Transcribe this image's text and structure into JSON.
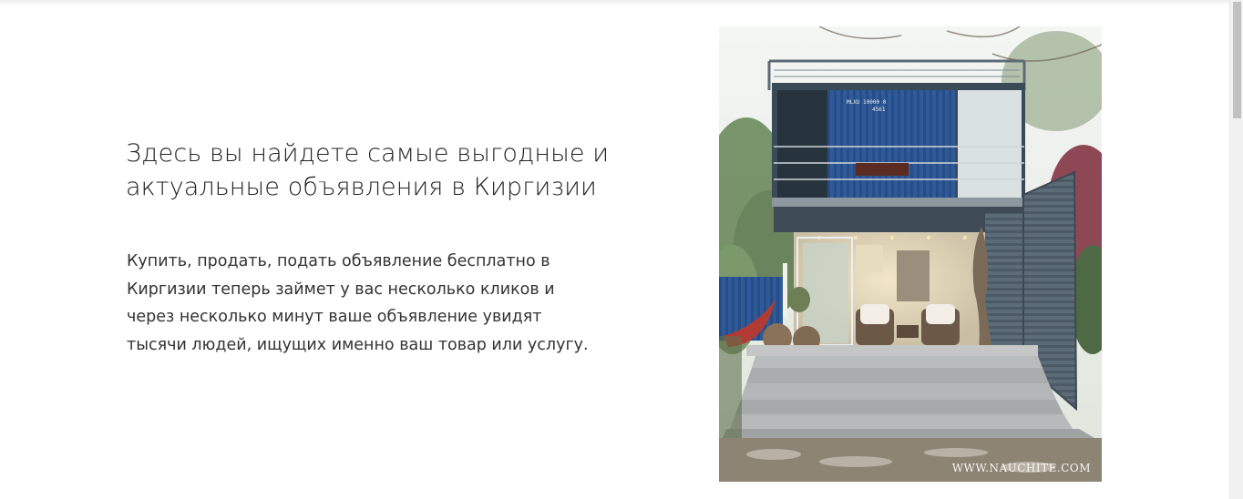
{
  "content": {
    "headline": "Здесь вы найдете самые выгодные и актуальные объявления в Киргизии",
    "description": "Купить, продать, подать объявление бесплатно в Киргизии теперь займет у вас несколько кликов и через несколько минут ваше объявление увидят тысячи людей, ищущих именно ваш товар или услугу."
  },
  "image": {
    "subject": "two-storey shipping container house",
    "watermark": "WWW.NAUCHITE.COM"
  },
  "colors": {
    "container_blue": "#2f5a9a",
    "steel_grey": "#5a6a78",
    "concrete": "#b9bcbc"
  }
}
